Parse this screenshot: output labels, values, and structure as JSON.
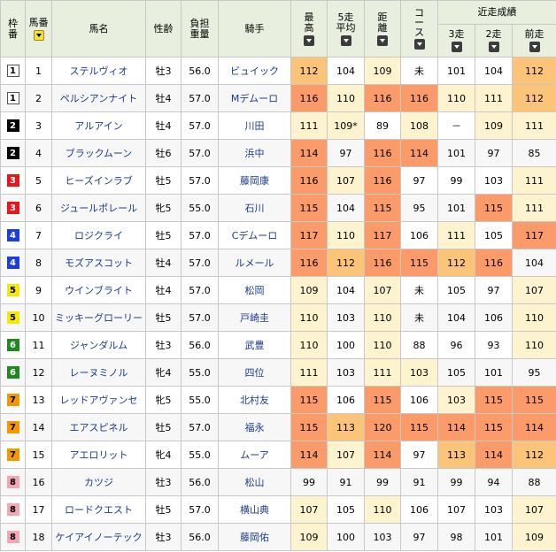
{
  "header": {
    "waku": "枠番",
    "umaban": "馬番",
    "name": "馬名",
    "sexage": "性齢",
    "weight": "負担重量",
    "jockey": "騎手",
    "max": "最高",
    "avg5": "5走平均",
    "dist": "距離",
    "course": "コース",
    "recent_group": "近走成績",
    "r3": "3走",
    "r2": "2走",
    "r1": "前走"
  },
  "colors": {
    "waku_1": "#ffffff",
    "waku_2": "#000000",
    "waku_3": "#e8151b",
    "waku_4": "#1c3fd8",
    "waku_5": "#f5e900",
    "waku_6": "#1e8a1e",
    "waku_7": "#f39800",
    "waku_8": "#f4a6b8",
    "cell_max": "#fb9b6a",
    "cell_high": "#fbc478",
    "cell_mid": "#fdf3cf"
  },
  "rows": [
    {
      "waku": "1",
      "umaban": "1",
      "name": "ステルヴィオ",
      "sexage": "牡3",
      "weight": "56.0",
      "jockey": "ビュイック",
      "max": "112",
      "avg5": "104",
      "dist": "109",
      "course": "未",
      "r3": "101",
      "r2": "104",
      "r1": "112"
    },
    {
      "waku": "1",
      "umaban": "2",
      "name": "ペルシアンナイト",
      "sexage": "牡4",
      "weight": "57.0",
      "jockey": "Mデムーロ",
      "max": "116",
      "avg5": "110",
      "dist": "116",
      "course": "116",
      "r3": "110",
      "r2": "111",
      "r1": "112"
    },
    {
      "waku": "2",
      "umaban": "3",
      "name": "アルアイン",
      "sexage": "牡4",
      "weight": "57.0",
      "jockey": "川田",
      "max": "111",
      "avg5": "109*",
      "dist": "89",
      "course": "108",
      "r3": "－",
      "r2": "109",
      "r1": "111"
    },
    {
      "waku": "2",
      "umaban": "4",
      "name": "ブラックムーン",
      "sexage": "牡6",
      "weight": "57.0",
      "jockey": "浜中",
      "max": "114",
      "avg5": "97",
      "dist": "116",
      "course": "114",
      "r3": "101",
      "r2": "97",
      "r1": "85"
    },
    {
      "waku": "3",
      "umaban": "5",
      "name": "ヒーズインラブ",
      "sexage": "牡5",
      "weight": "57.0",
      "jockey": "藤岡康",
      "max": "116",
      "avg5": "107",
      "dist": "116",
      "course": "97",
      "r3": "99",
      "r2": "103",
      "r1": "111"
    },
    {
      "waku": "3",
      "umaban": "6",
      "name": "ジュールポレール",
      "sexage": "牝5",
      "weight": "55.0",
      "jockey": "石川",
      "max": "115",
      "avg5": "104",
      "dist": "115",
      "course": "95",
      "r3": "101",
      "r2": "115",
      "r1": "111"
    },
    {
      "waku": "4",
      "umaban": "7",
      "name": "ロジクライ",
      "sexage": "牡5",
      "weight": "57.0",
      "jockey": "Cデムーロ",
      "max": "117",
      "avg5": "110",
      "dist": "117",
      "course": "106",
      "r3": "111",
      "r2": "105",
      "r1": "117"
    },
    {
      "waku": "4",
      "umaban": "8",
      "name": "モズアスコット",
      "sexage": "牡4",
      "weight": "57.0",
      "jockey": "ルメール",
      "max": "116",
      "avg5": "112",
      "dist": "116",
      "course": "115",
      "r3": "112",
      "r2": "116",
      "r1": "104"
    },
    {
      "waku": "5",
      "umaban": "9",
      "name": "ウインブライト",
      "sexage": "牡4",
      "weight": "57.0",
      "jockey": "松岡",
      "max": "109",
      "avg5": "104",
      "dist": "107",
      "course": "未",
      "r3": "105",
      "r2": "97",
      "r1": "107"
    },
    {
      "waku": "5",
      "umaban": "10",
      "name": "ミッキーグローリー",
      "sexage": "牡5",
      "weight": "57.0",
      "jockey": "戸崎圭",
      "max": "110",
      "avg5": "103",
      "dist": "110",
      "course": "未",
      "r3": "104",
      "r2": "106",
      "r1": "110"
    },
    {
      "waku": "6",
      "umaban": "11",
      "name": "ジャンダルム",
      "sexage": "牡3",
      "weight": "56.0",
      "jockey": "武豊",
      "max": "110",
      "avg5": "100",
      "dist": "110",
      "course": "88",
      "r3": "96",
      "r2": "93",
      "r1": "110"
    },
    {
      "waku": "6",
      "umaban": "12",
      "name": "レーヌミノル",
      "sexage": "牝4",
      "weight": "55.0",
      "jockey": "四位",
      "max": "111",
      "avg5": "103",
      "dist": "111",
      "course": "103",
      "r3": "105",
      "r2": "101",
      "r1": "95"
    },
    {
      "waku": "7",
      "umaban": "13",
      "name": "レッドアヴァンセ",
      "sexage": "牝5",
      "weight": "55.0",
      "jockey": "北村友",
      "max": "115",
      "avg5": "106",
      "dist": "115",
      "course": "106",
      "r3": "103",
      "r2": "115",
      "r1": "115"
    },
    {
      "waku": "7",
      "umaban": "14",
      "name": "エアスピネル",
      "sexage": "牡5",
      "weight": "57.0",
      "jockey": "福永",
      "max": "115",
      "avg5": "113",
      "dist": "120",
      "course": "115",
      "r3": "114",
      "r2": "115",
      "r1": "114"
    },
    {
      "waku": "7",
      "umaban": "15",
      "name": "アエロリット",
      "sexage": "牝4",
      "weight": "55.0",
      "jockey": "ムーア",
      "max": "114",
      "avg5": "107",
      "dist": "114",
      "course": "97",
      "r3": "113",
      "r2": "114",
      "r1": "112"
    },
    {
      "waku": "8",
      "umaban": "16",
      "name": "カツジ",
      "sexage": "牡3",
      "weight": "56.0",
      "jockey": "松山",
      "max": "99",
      "avg5": "91",
      "dist": "99",
      "course": "91",
      "r3": "99",
      "r2": "94",
      "r1": "88"
    },
    {
      "waku": "8",
      "umaban": "17",
      "name": "ロードクエスト",
      "sexage": "牡5",
      "weight": "57.0",
      "jockey": "横山典",
      "max": "107",
      "avg5": "105",
      "dist": "110",
      "course": "106",
      "r3": "107",
      "r2": "103",
      "r1": "107"
    },
    {
      "waku": "8",
      "umaban": "18",
      "name": "ケイアイノーテック",
      "sexage": "牡3",
      "weight": "56.0",
      "jockey": "藤岡佑",
      "max": "109",
      "avg5": "100",
      "dist": "103",
      "course": "97",
      "r3": "98",
      "r2": "101",
      "r1": "109"
    }
  ]
}
